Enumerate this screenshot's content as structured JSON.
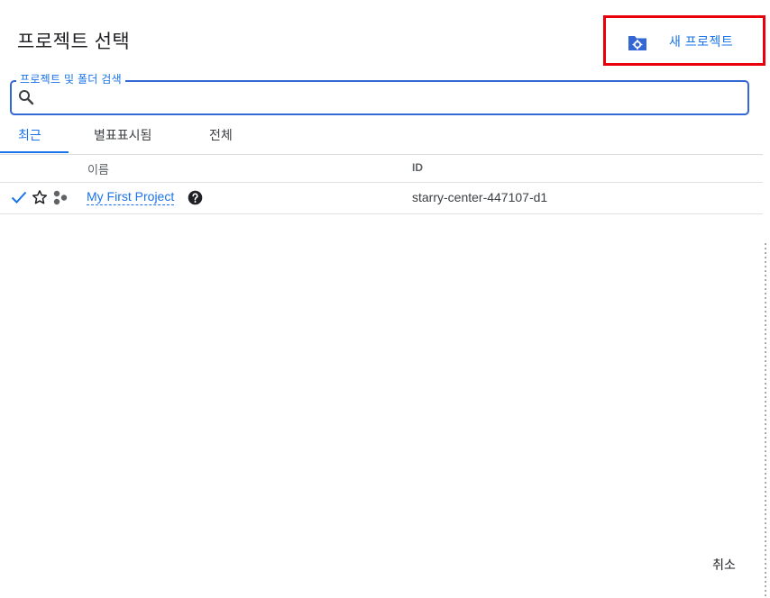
{
  "dialog": {
    "title": "프로젝트 선택",
    "new_project_label": "새 프로젝트"
  },
  "search": {
    "legend": "프로젝트 및 폴더 검색",
    "value": "",
    "placeholder": ""
  },
  "tabs": [
    {
      "label": "최근",
      "active": true
    },
    {
      "label": "별표표시됨",
      "active": false
    },
    {
      "label": "전체",
      "active": false
    }
  ],
  "table": {
    "columns": [
      "이름",
      "ID"
    ],
    "rows": [
      {
        "selected": true,
        "starred": false,
        "name": "My First Project",
        "id": "starry-center-447107-d1"
      }
    ]
  },
  "footer": {
    "cancel_label": "취소"
  },
  "colors": {
    "accent": "#1a73e8",
    "highlight_box": "#e8000b"
  },
  "icons": [
    "folder-settings-icon",
    "search-icon",
    "check-icon",
    "star-outline-icon",
    "organization-icon",
    "help-icon"
  ]
}
